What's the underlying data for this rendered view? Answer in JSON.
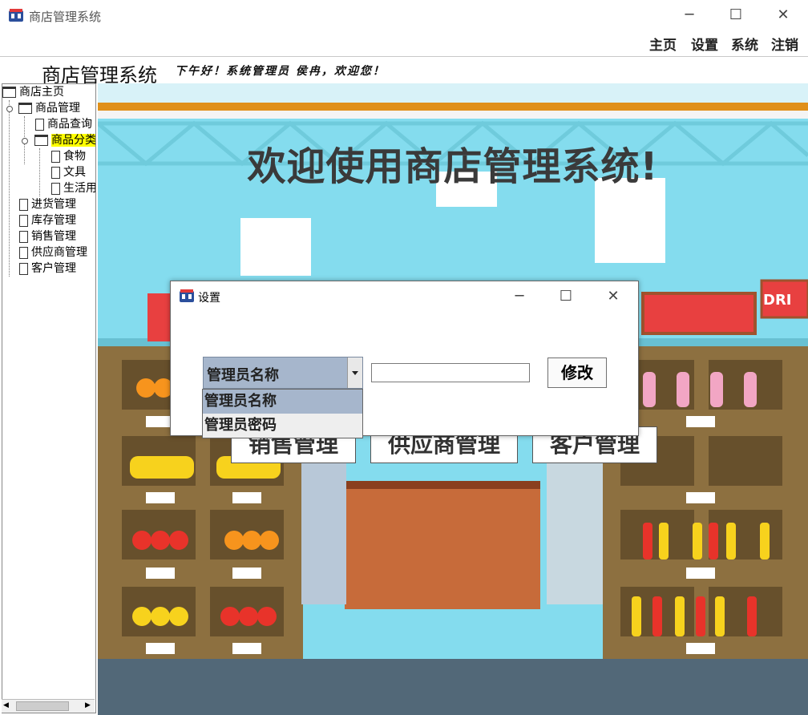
{
  "window": {
    "title": "商店管理系统"
  },
  "menu": [
    "主页",
    "设置",
    "系统",
    "注销"
  ],
  "header": {
    "title": "商店管理系统",
    "greeting": "下午好！系统管理员 侯冉，欢迎您！"
  },
  "tree": [
    {
      "label": "商店主页",
      "type": "folder"
    },
    {
      "label": "商品管理",
      "type": "folder"
    },
    {
      "label": "商品查询",
      "type": "doc"
    },
    {
      "label": "商品分类",
      "type": "folder",
      "selected": true
    },
    {
      "label": "食物",
      "type": "doc"
    },
    {
      "label": "文具",
      "type": "doc"
    },
    {
      "label": "生活用品",
      "type": "doc"
    },
    {
      "label": "进货管理",
      "type": "doc"
    },
    {
      "label": "库存管理",
      "type": "doc"
    },
    {
      "label": "销售管理",
      "type": "doc"
    },
    {
      "label": "供应商管理",
      "type": "doc"
    },
    {
      "label": "客户管理",
      "type": "doc"
    }
  ],
  "scene": {
    "title": "欢迎使用商店管理系统!",
    "sign": "DRI",
    "buttons": [
      "销售管理",
      "供应商管理",
      "客户管理"
    ]
  },
  "dialog": {
    "title": "设置",
    "combo_value": "管理员名称",
    "input_value": "",
    "button": "修改",
    "options": [
      "管理员名称",
      "管理员密码"
    ]
  },
  "colors": {
    "selection": "#ffff00",
    "combo": "#a6b6cc",
    "scene_bg": "#84dcee"
  }
}
